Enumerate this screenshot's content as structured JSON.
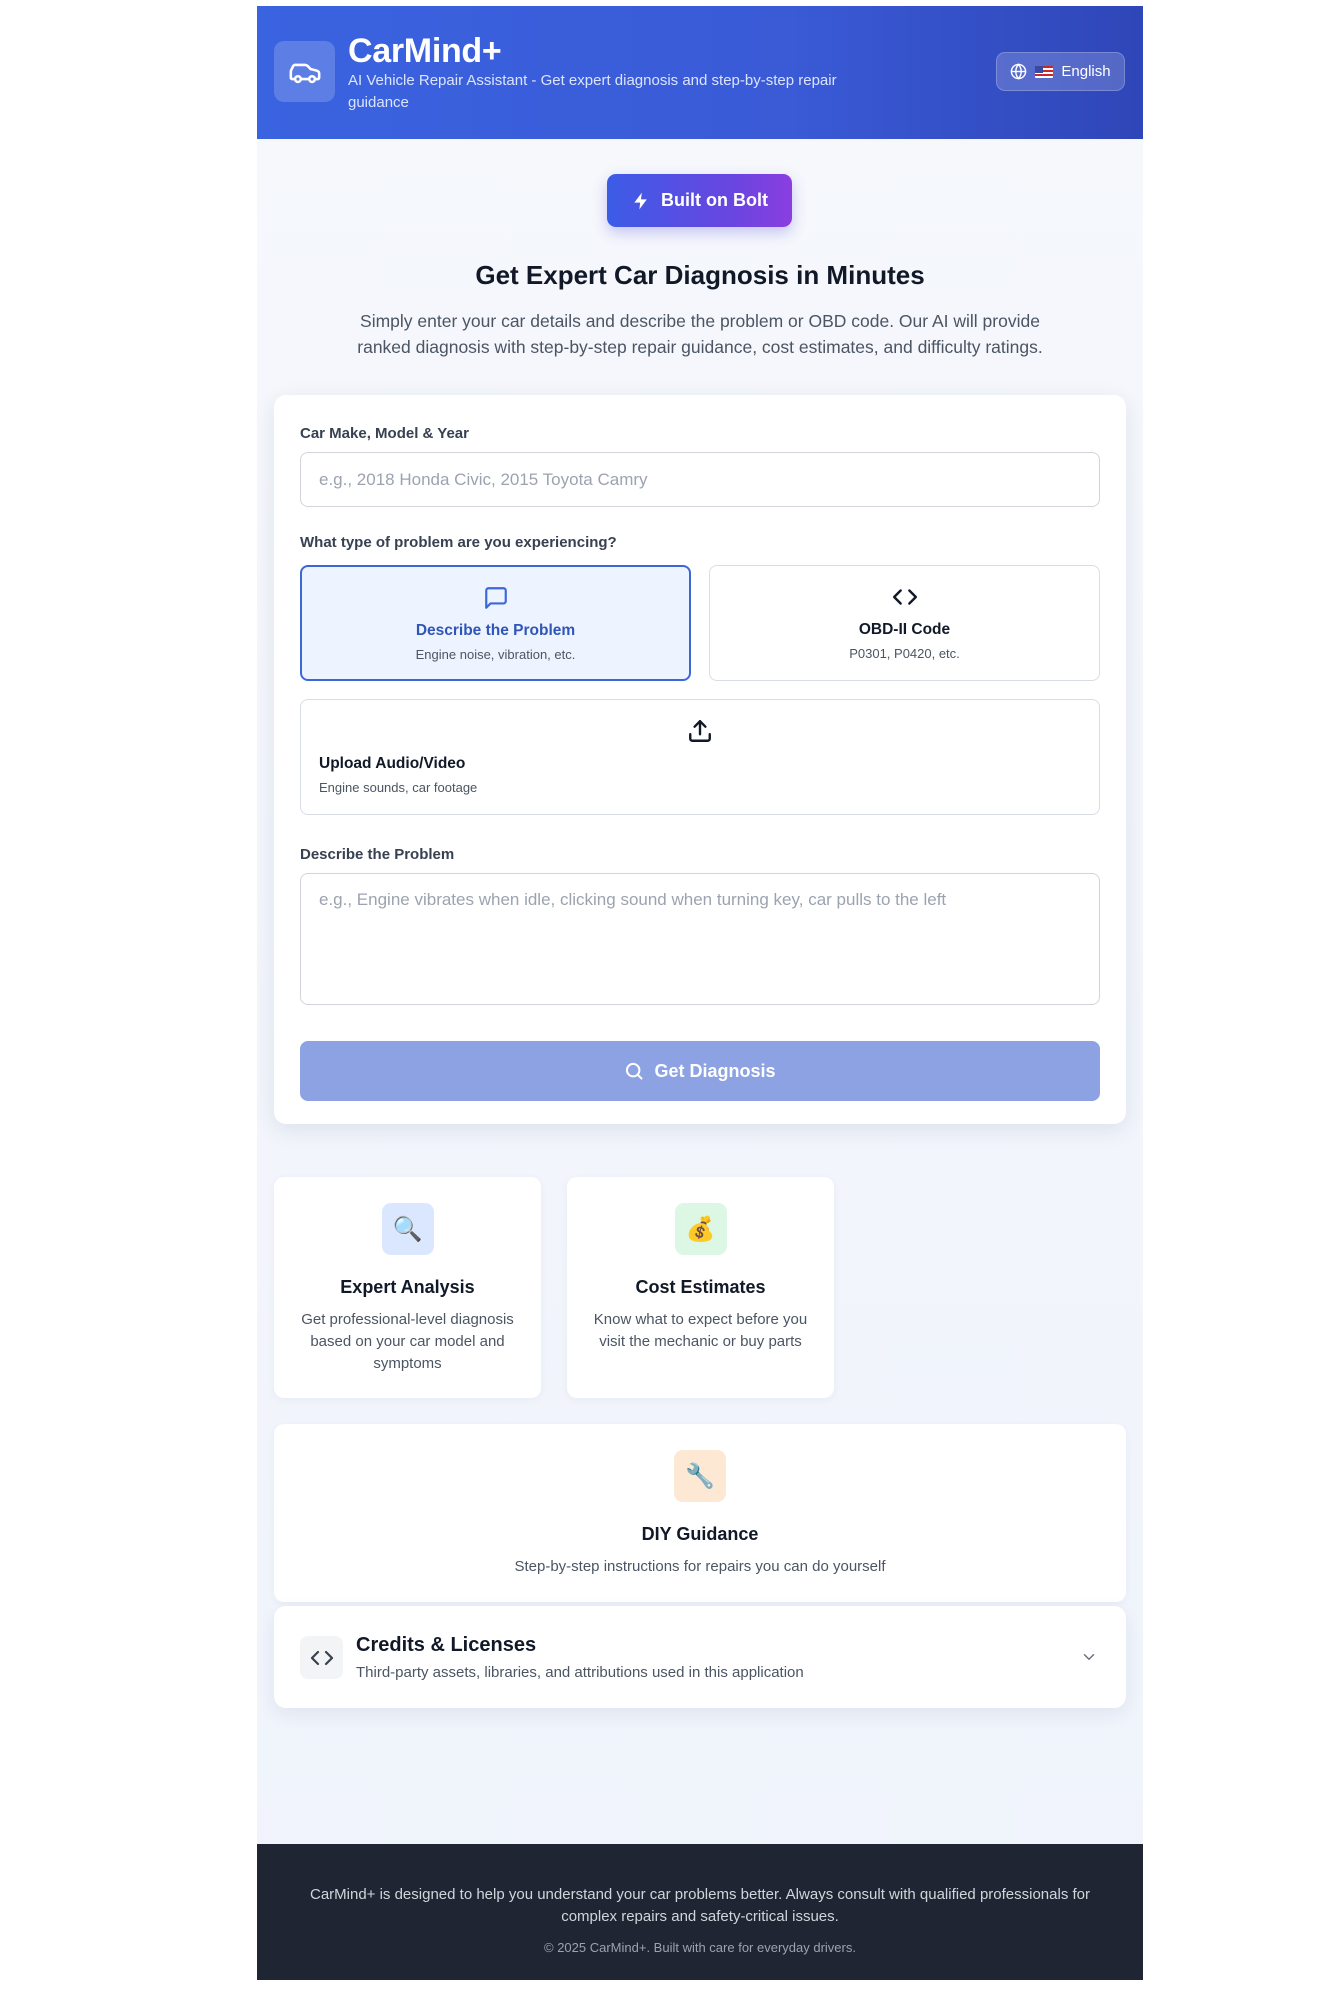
{
  "header": {
    "title": "CarMind+",
    "subtitle": "AI Vehicle Repair Assistant - Get expert diagnosis and step-by-step repair guidance",
    "language": "English",
    "icons": {
      "logo": "car-icon",
      "language": "globe-icon",
      "flag": "us-flag-icon"
    }
  },
  "badge": {
    "label": "Built on Bolt",
    "icon": "lightning-bolt-icon"
  },
  "hero": {
    "title": "Get Expert Car Diagnosis in Minutes",
    "description": "Simply enter your car details and describe the problem or OBD code. Our AI will provide ranked diagnosis with step-by-step repair guidance, cost estimates, and difficulty ratings."
  },
  "form": {
    "car_label": "Car Make, Model & Year",
    "car_placeholder": "e.g., 2018 Honda Civic, 2015 Toyota Camry",
    "car_value": "",
    "problem_type_label": "What type of problem are you experiencing?",
    "options": [
      {
        "title": "Describe the Problem",
        "subtitle": "Engine noise, vibration, etc.",
        "icon": "chat-bubble-icon",
        "selected": true
      },
      {
        "title": "OBD-II Code",
        "subtitle": "P0301, P0420, etc.",
        "icon": "code-brackets-icon",
        "selected": false
      },
      {
        "title": "Upload Audio/Video",
        "subtitle": "Engine sounds, car footage",
        "icon": "upload-icon",
        "selected": false
      }
    ],
    "description_label": "Describe the Problem",
    "description_placeholder": "e.g., Engine vibrates when idle, clicking sound when turning key, car pulls to the left",
    "description_value": "",
    "submit_label": "Get Diagnosis",
    "submit_icon": "search-icon"
  },
  "features": [
    {
      "title": "Expert Analysis",
      "description": "Get professional-level diagnosis based on your car model and symptoms",
      "icon": "magnifier-emoji-icon",
      "emoji": "🔍",
      "bg": "#dbe7ff"
    },
    {
      "title": "Cost Estimates",
      "description": "Know what to expect before you visit the mechanic or buy parts",
      "icon": "money-bag-emoji-icon",
      "emoji": "💰",
      "bg": "#dcf7e3"
    },
    {
      "title": "DIY Guidance",
      "description": "Step-by-step instructions for repairs you can do yourself",
      "icon": "wrench-emoji-icon",
      "emoji": "🔧",
      "bg": "#fde9d3"
    }
  ],
  "credits": {
    "title": "Credits & Licenses",
    "description": "Third-party assets, libraries, and attributions used in this application",
    "icon": "code-brackets-icon",
    "chevron": "chevron-down-icon"
  },
  "footer": {
    "disclaimer": "CarMind+ is designed to help you understand your car problems better. Always consult with qualified professionals for complex repairs and safety-critical issues.",
    "copyright": "© 2025 CarMind+. Built with care for everyday drivers."
  },
  "colors": {
    "header_start": "#3a63e0",
    "header_end": "#2f46b8",
    "accent": "#3b67d9",
    "submit_disabled": "#8da2e3",
    "footer_bg": "#1f2533"
  }
}
